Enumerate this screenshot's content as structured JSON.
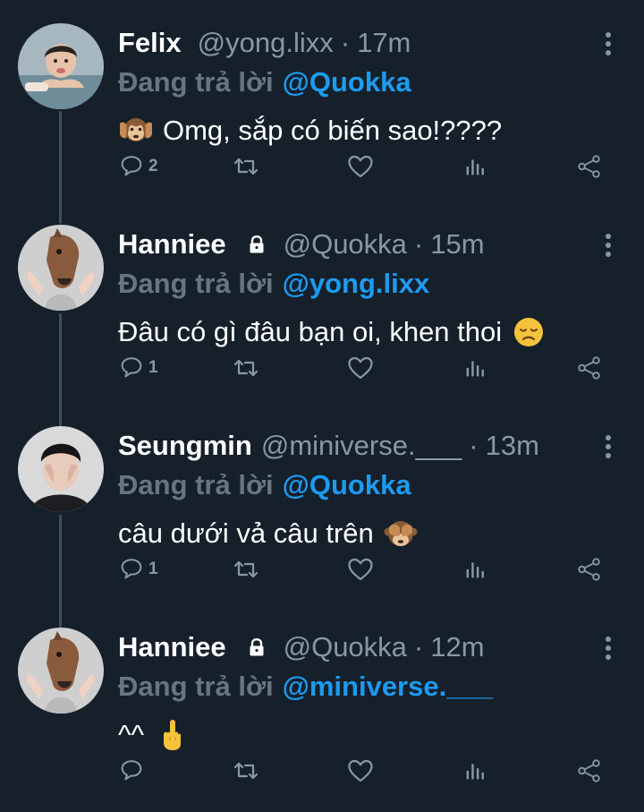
{
  "colors": {
    "background": "#15202b",
    "name": "#ffffff",
    "muted": "#8899a6",
    "reply_prefix": "#687684",
    "mention": "#1d9bf0",
    "thread_line": "#3d4e5f"
  },
  "tweets": [
    {
      "name": "Felix",
      "handle": "@yong.lixx",
      "separator": "·",
      "time": "17m",
      "locked": false,
      "reply_prefix": "Đang trả lời",
      "reply_to": "@Quokka",
      "emoji_before": "hear-no-evil-monkey",
      "text": "Omg, sắp có biến sao!????",
      "reply_count": "2",
      "avatar": "baby-photo"
    },
    {
      "name": "Hanniee",
      "handle": "@Quokka",
      "separator": "·",
      "time": "15m",
      "locked": true,
      "reply_prefix": "Đang trả lời",
      "reply_to": "@yong.lixx",
      "text": "Đâu có gì đâu bạn oi, khen thoi",
      "emoji_after": "disappointed-face",
      "reply_count": "1",
      "avatar": "horse-mask"
    },
    {
      "name": "Seungmin",
      "handle": "@miniverse.___",
      "separator": "·",
      "time": "13m",
      "locked": false,
      "reply_prefix": "Đang trả lời",
      "reply_to": "@Quokka",
      "text": "câu dưới vả câu trên",
      "emoji_after": "see-no-evil-monkey",
      "reply_count": "1",
      "avatar": "boy-covering-face"
    },
    {
      "name": "Hanniee",
      "handle": "@Quokka",
      "separator": "·",
      "time": "12m",
      "locked": true,
      "reply_prefix": "Đang trả lời",
      "reply_to": "@miniverse.___",
      "text": "^^",
      "emoji_after": "middle-finger",
      "reply_count": "",
      "avatar": "horse-mask"
    }
  ],
  "icons": {
    "reply": "reply-icon",
    "retweet": "retweet-icon",
    "like": "heart-icon",
    "views": "analytics-icon",
    "share": "share-icon",
    "more": "more-icon",
    "lock": "lock-icon"
  }
}
